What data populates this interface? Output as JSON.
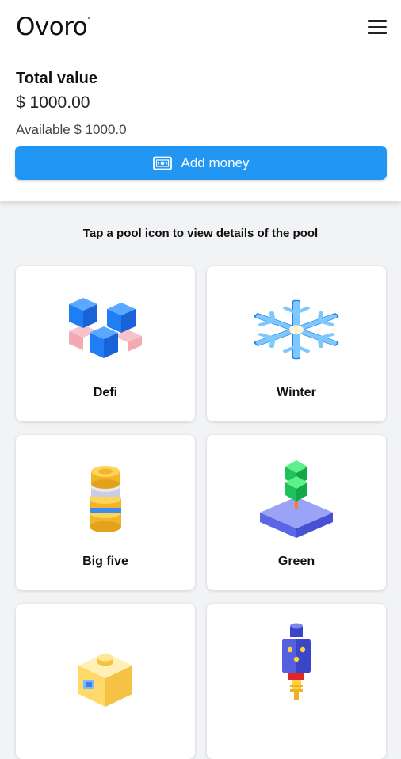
{
  "app": {
    "logo": "Ovoro",
    "logo_mark": "°"
  },
  "summary": {
    "total_label": "Total value",
    "total_amount": "$ 1000.00",
    "available_text": "Available $ 1000.0",
    "add_money_label": "Add money",
    "add_money_icon": "money-bill-icon"
  },
  "pools": {
    "hint": "Tap a pool icon to view details of the pool",
    "items": [
      {
        "name": "Defi",
        "icon": "blue-cubes-icon"
      },
      {
        "name": "Winter",
        "icon": "snowflake-icon"
      },
      {
        "name": "Big five",
        "icon": "coin-stack-icon"
      },
      {
        "name": "Green",
        "icon": "tree-platform-icon"
      },
      {
        "name": "",
        "icon": "yellow-box-icon"
      },
      {
        "name": "",
        "icon": "robot-tower-icon"
      }
    ]
  },
  "colors": {
    "accent": "#2196f3",
    "background": "#f2f3f5",
    "card": "#ffffff"
  }
}
